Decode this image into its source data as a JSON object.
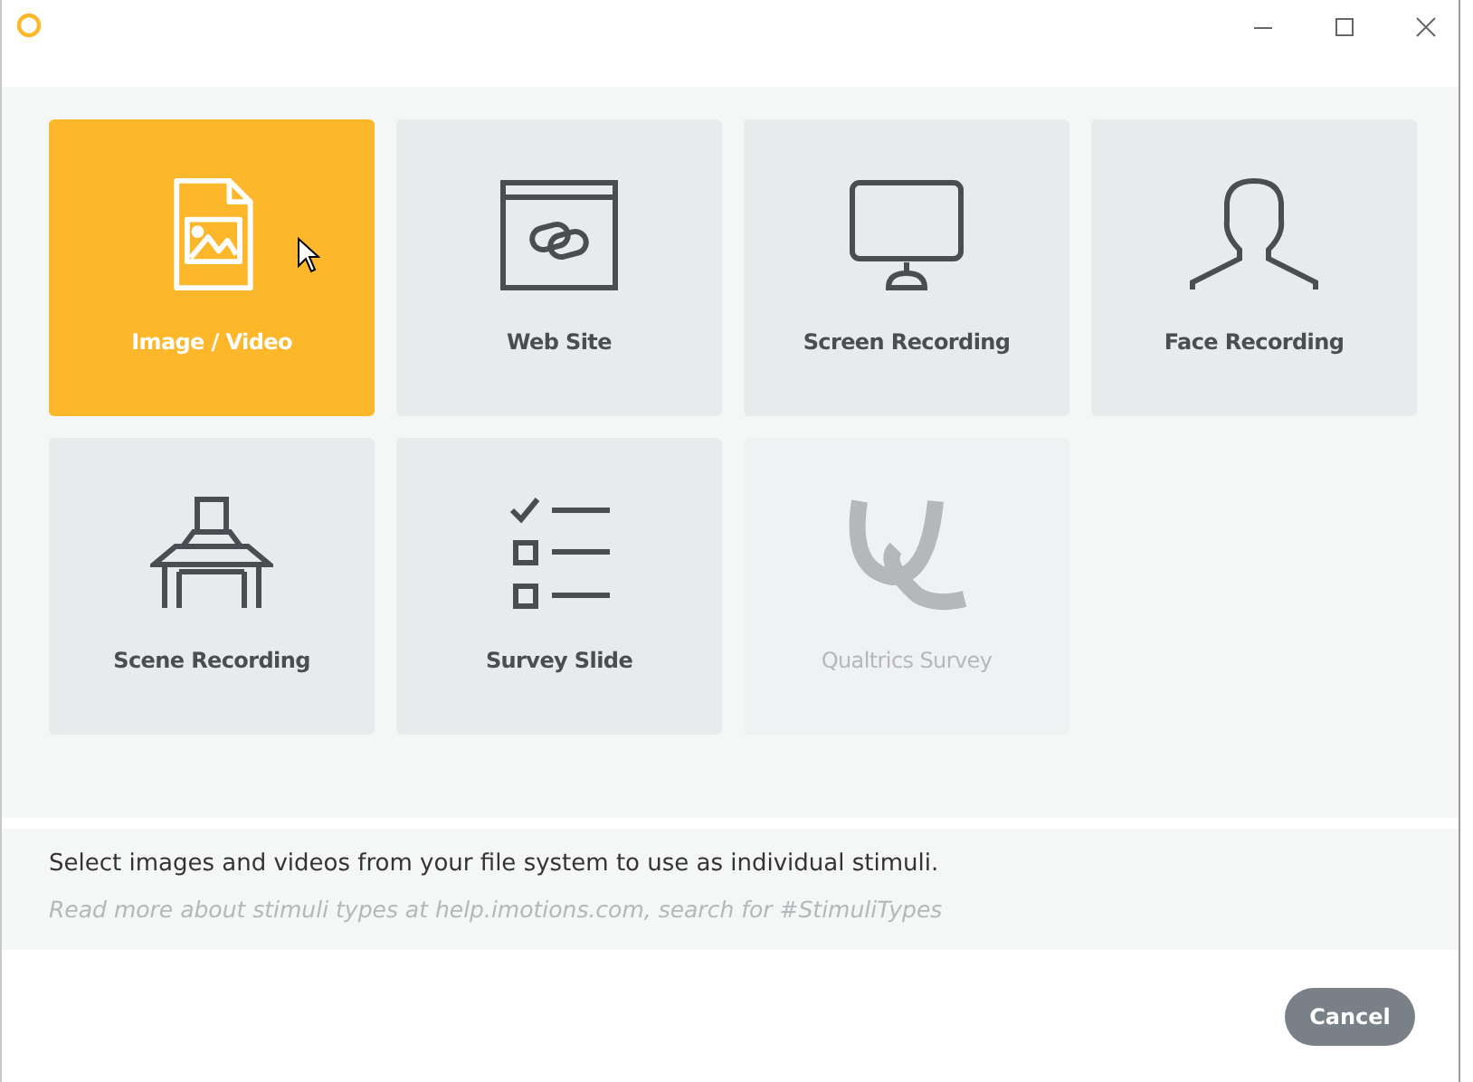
{
  "tiles": [
    {
      "label": "Image / Video",
      "kind": "image",
      "selected": true,
      "disabled": false
    },
    {
      "label": "Web Site",
      "kind": "web",
      "selected": false,
      "disabled": false
    },
    {
      "label": "Screen Recording",
      "kind": "screen",
      "selected": false,
      "disabled": false
    },
    {
      "label": "Face Recording",
      "kind": "face",
      "selected": false,
      "disabled": false
    },
    {
      "label": "Scene Recording",
      "kind": "scene",
      "selected": false,
      "disabled": false
    },
    {
      "label": "Survey Slide",
      "kind": "survey",
      "selected": false,
      "disabled": false
    },
    {
      "label": "Qualtrics Survey",
      "kind": "qualtrics",
      "selected": false,
      "disabled": true
    }
  ],
  "description": "Select images and videos from your file system to use as individual stimuli.",
  "hint": "Read more about stimuli types at help.imotions.com, search for #StimuliTypes",
  "buttons": [
    "Cancel"
  ]
}
